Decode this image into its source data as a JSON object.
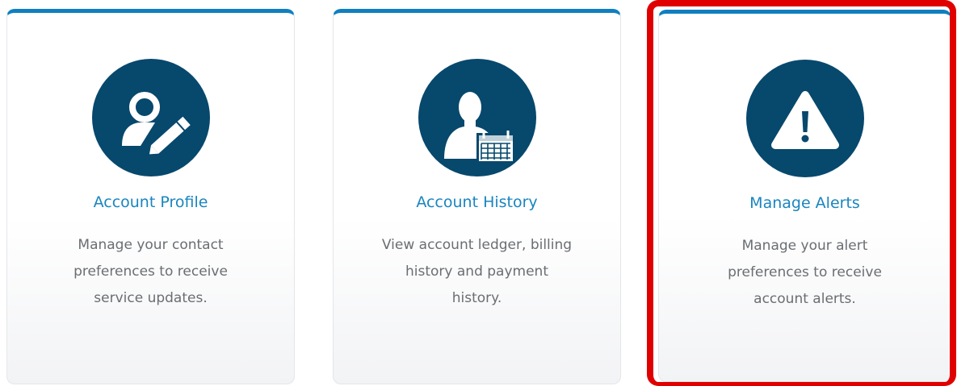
{
  "cards": [
    {
      "title": "Account Profile",
      "description": [
        "Manage your contact",
        "preferences to receive",
        "service updates."
      ],
      "icon": "user-edit-icon"
    },
    {
      "title": "Account History",
      "description": [
        "View account ledger, billing",
        "history and payment",
        "history."
      ],
      "icon": "user-calendar-icon"
    },
    {
      "title": "Manage Alerts",
      "description": [
        "Manage your alert",
        "preferences to receive",
        "account alerts."
      ],
      "icon": "warning-icon",
      "highlighted": true
    }
  ],
  "colors": {
    "accent_bar": "#0f7fc0",
    "icon_circle": "#07486d",
    "title_text": "#1985bf",
    "body_text": "#6a6e72",
    "highlight": "#e00000"
  }
}
